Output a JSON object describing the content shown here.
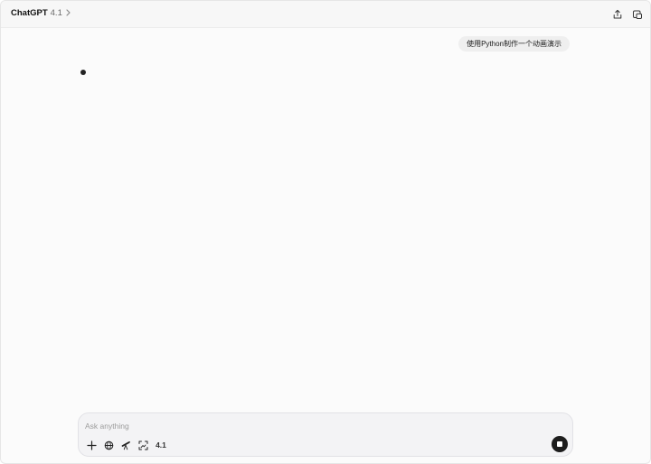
{
  "header": {
    "model_name": "ChatGPT",
    "model_version": "4.1",
    "chevron_icon": "chevron-right-icon",
    "share_icon": "share-icon",
    "new_window_icon": "open-window-icon"
  },
  "conversation": {
    "user_message": "使用Python制作一个动画演示",
    "assistant_state": "typing-dot"
  },
  "composer": {
    "placeholder": "Ask anything",
    "value": "",
    "tools": [
      {
        "name": "plus-icon"
      },
      {
        "name": "globe-icon"
      },
      {
        "name": "telescope-icon"
      },
      {
        "name": "image-scan-icon"
      }
    ],
    "model_label": "4.1",
    "stop_icon": "stop-icon"
  },
  "colors": {
    "accent": "#1d1d1d",
    "background": "#fbfbfb",
    "bubble": "#efefef"
  }
}
